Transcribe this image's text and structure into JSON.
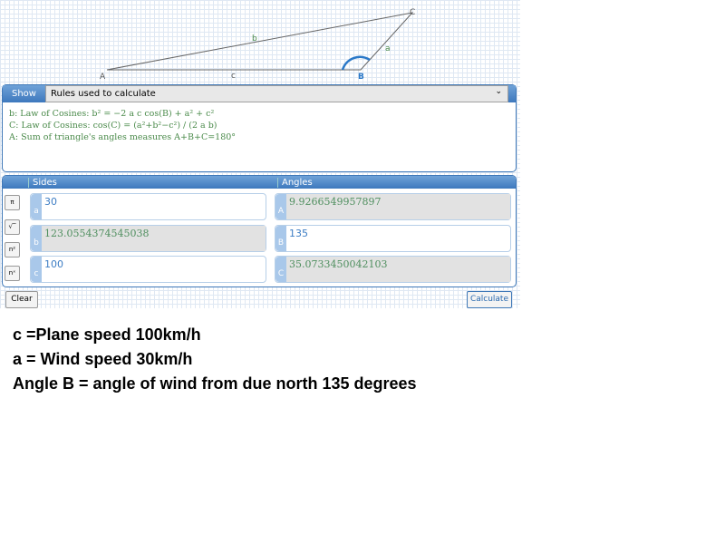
{
  "diagram": {
    "vertices": {
      "A": "A",
      "B": "B",
      "C": "C"
    },
    "sides": {
      "a": "a",
      "b": "b",
      "c": "c"
    }
  },
  "rules_panel": {
    "show_label": "Show",
    "select_value": "Rules used to calculate",
    "rules": [
      "b: Law of Cosines: b² = −2 a c cos(B) + a² + c²",
      "C: Law of Cosines: cos(C) = (a²+b²−c²) / (2 a b)",
      "A: Sum of triangle's angles measures  A+B+C=180°"
    ]
  },
  "sides": {
    "header": "Sides",
    "a": {
      "label": "a",
      "value": "30"
    },
    "b": {
      "label": "b",
      "value": "123.0554374545038"
    },
    "c": {
      "label": "c",
      "value": "100"
    }
  },
  "angles": {
    "header": "Angles",
    "A": {
      "label": "A",
      "value": "9.9266549957897"
    },
    "B": {
      "label": "B",
      "value": "135"
    },
    "C": {
      "label": "C",
      "value": "35.0733450042103"
    }
  },
  "functions": [
    "π",
    "√‾",
    "n²",
    "nˣ"
  ],
  "buttons": {
    "clear": "Clear",
    "calculate": "Calculate"
  },
  "notes": [
    "c =Plane speed 100km/h",
    "a = Wind speed 30km/h",
    "Angle B = angle of wind from due north 135 degrees"
  ]
}
